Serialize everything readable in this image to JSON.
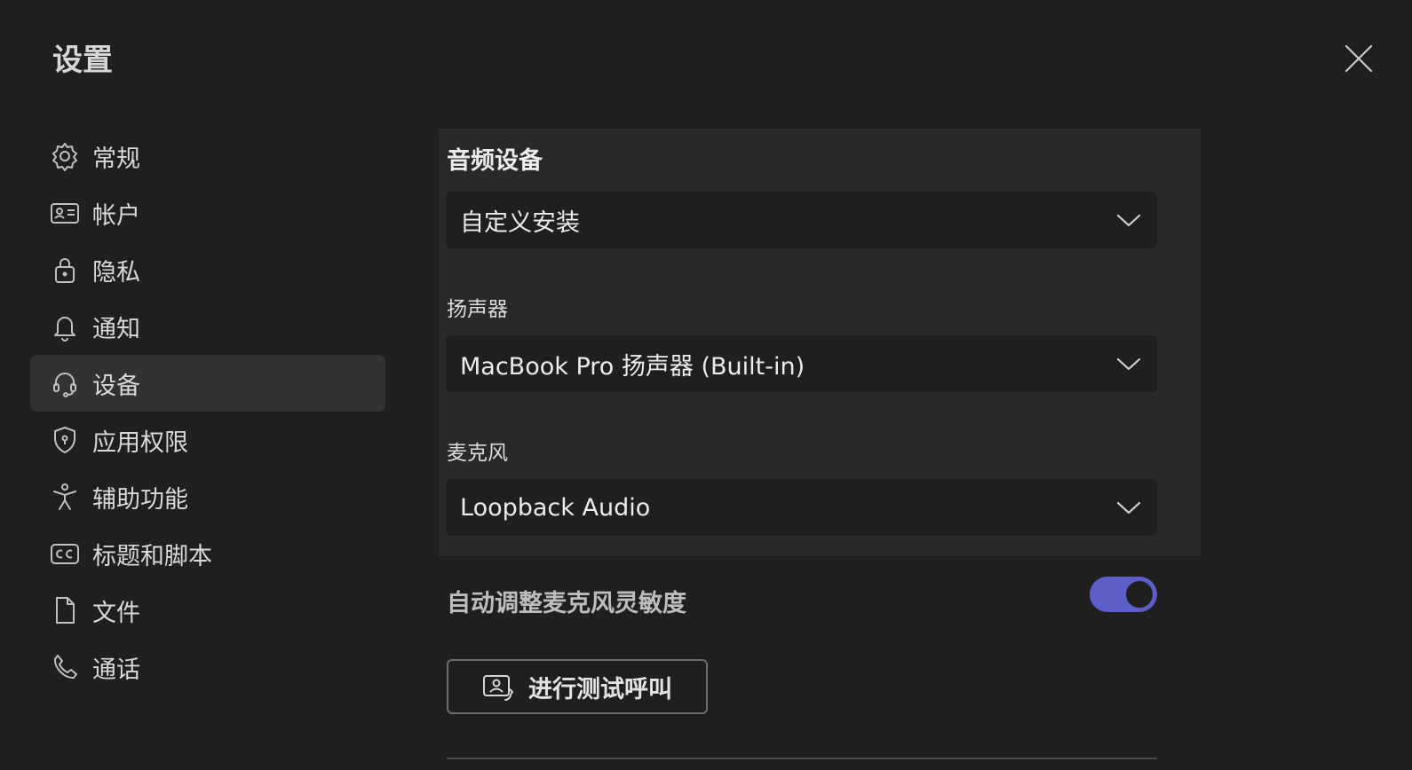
{
  "dialog": {
    "title": "设置",
    "close_icon": "close-icon"
  },
  "sidebar": {
    "items": [
      {
        "label": "常规",
        "icon": "gear-icon",
        "active": false
      },
      {
        "label": "帐户",
        "icon": "id-card-icon",
        "active": false
      },
      {
        "label": "隐私",
        "icon": "lock-icon",
        "active": false
      },
      {
        "label": "通知",
        "icon": "bell-icon",
        "active": false
      },
      {
        "label": "设备",
        "icon": "headset-icon",
        "active": true
      },
      {
        "label": "应用权限",
        "icon": "shield-icon",
        "active": false
      },
      {
        "label": "辅助功能",
        "icon": "accessibility-icon",
        "active": false
      },
      {
        "label": "标题和脚本",
        "icon": "closed-captions-icon",
        "active": false
      },
      {
        "label": "文件",
        "icon": "file-icon",
        "active": false
      },
      {
        "label": "通话",
        "icon": "phone-icon",
        "active": false
      }
    ]
  },
  "audio": {
    "heading": "音频设备",
    "device_select": {
      "value": "自定义安装"
    },
    "speaker": {
      "label": "扬声器",
      "value": "MacBook Pro 扬声器 (Built-in)"
    },
    "microphone": {
      "label": "麦克风",
      "value": "Loopback Audio"
    },
    "auto_adjust": {
      "label": "自动调整麦克风灵敏度",
      "enabled": true
    },
    "test_call": {
      "label": "进行测试呼叫",
      "icon": "test-call-icon"
    }
  },
  "colors": {
    "background": "#1f1f1f",
    "section_bg": "#292929",
    "accent": "#5b5fc7",
    "active_nav": "#333231"
  }
}
